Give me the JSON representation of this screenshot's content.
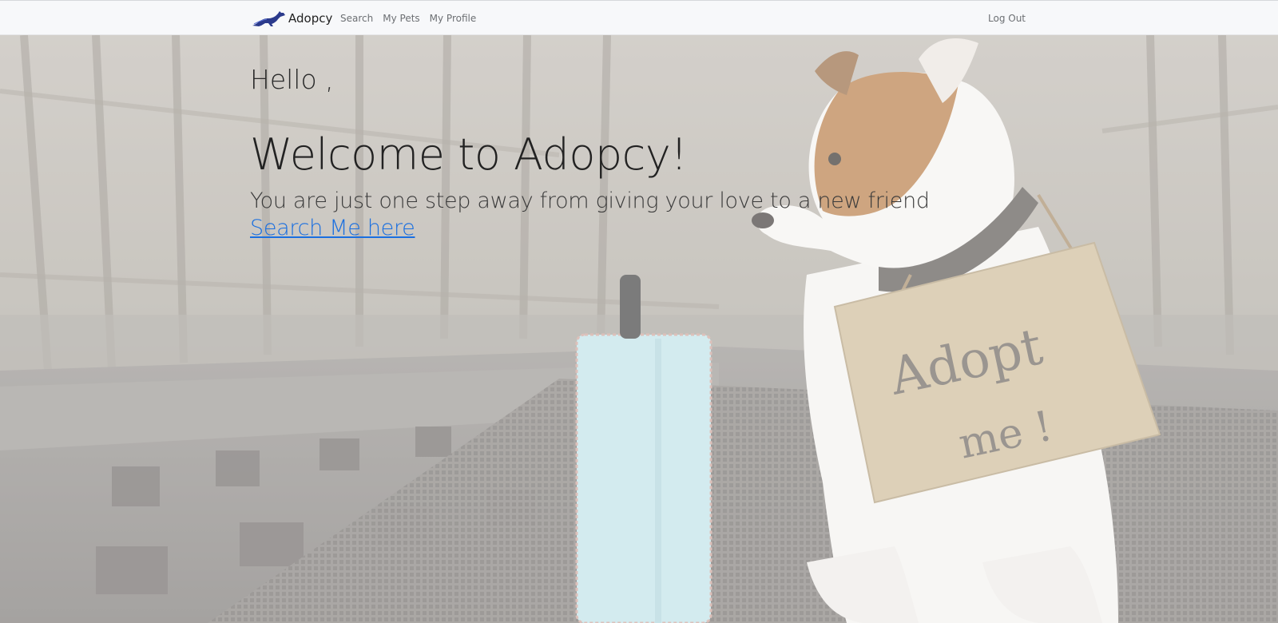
{
  "navbar": {
    "brand_name": "Adopcy",
    "brand_icon": "running-dog-logo",
    "links": [
      {
        "label": "Search"
      },
      {
        "label": "My Pets"
      },
      {
        "label": "My Profile"
      }
    ],
    "logout_label": "Log Out"
  },
  "hero": {
    "greeting": "Hello ,",
    "title": "Welcome to Adopcy!",
    "subtitle": "You are just one step away from giving your love to a new friend",
    "search_link": "Search Me here",
    "background_image": "dog-with-adopt-me-sign-and-suitcase",
    "sign_text": "Adopt me !"
  },
  "colors": {
    "navbar_bg": "#f7f8fa",
    "link_blue": "#1a6fe0",
    "brand_blue": "#2b3a8c",
    "text_dark": "#222222"
  }
}
